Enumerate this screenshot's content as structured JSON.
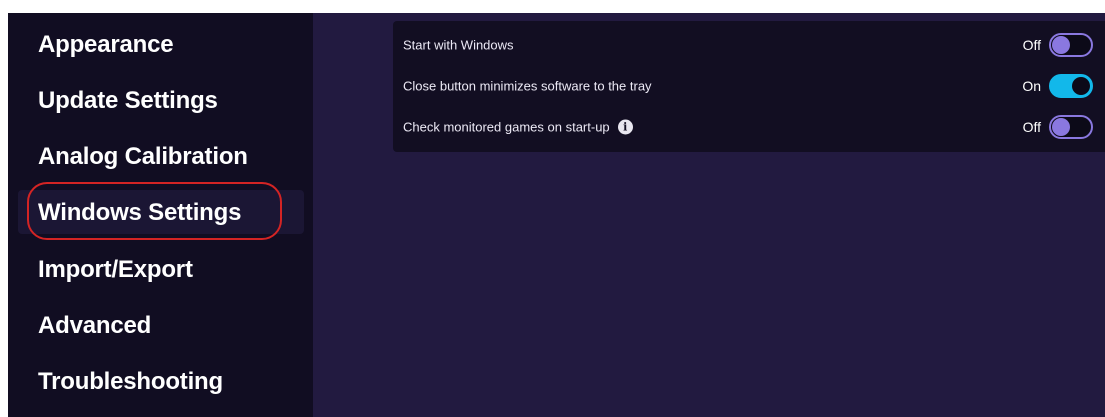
{
  "sidebar": {
    "items": [
      {
        "label": "Appearance"
      },
      {
        "label": "Update Settings"
      },
      {
        "label": "Analog Calibration"
      },
      {
        "label": "Windows Settings",
        "active": true
      },
      {
        "label": "Import/Export"
      },
      {
        "label": "Advanced"
      },
      {
        "label": "Troubleshooting"
      }
    ]
  },
  "settings": {
    "rows": [
      {
        "label": "Start with Windows",
        "state_text": "Off",
        "enabled": false
      },
      {
        "label": "Close button minimizes software to the tray",
        "state_text": "On",
        "enabled": true
      },
      {
        "label": "Check monitored games on start-up",
        "state_text": "Off",
        "enabled": false,
        "info_icon": "info-icon"
      }
    ]
  },
  "colors": {
    "sidebar_bg": "#110d22",
    "content_bg": "#221a40",
    "panel_bg": "#120e22",
    "toggle_off_accent": "#8a78e0",
    "toggle_on_accent": "#12b8ea",
    "annotation_ring": "#d42424"
  }
}
